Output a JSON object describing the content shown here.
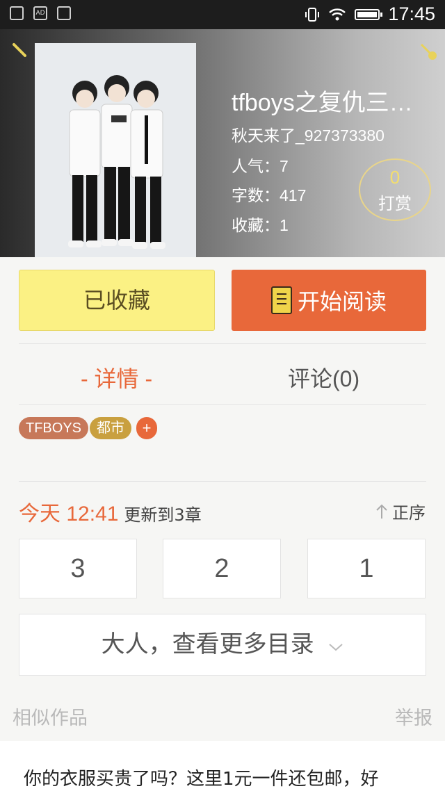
{
  "status_bar": {
    "time": "17:45"
  },
  "book": {
    "title": "tfboys之复仇三…",
    "author": "秋天来了_927373380",
    "popularity": "人气：7",
    "word_count": "字数：417",
    "favorites": "收藏：1",
    "reward_count": "0",
    "reward_label": "打赏"
  },
  "actions": {
    "favorite_label": "已收藏",
    "read_label": "开始阅读"
  },
  "tabs": {
    "details": "- 详情 -",
    "comments": "评论(0)"
  },
  "tags": [
    {
      "label": "TFBOYS",
      "color": "#c77859"
    },
    {
      "label": "都市",
      "color": "#c9a03f"
    },
    {
      "label": "+",
      "color": "#e8683a"
    }
  ],
  "update": {
    "time": "今天 12:41",
    "text": "更新到3章",
    "order_label": "正序"
  },
  "chapters": [
    "3",
    "2",
    "1"
  ],
  "more_catalog": "大人，查看更多目录",
  "similar": {
    "title": "相似作品",
    "report": "举报"
  },
  "ad": {
    "text": "你的衣服买贵了吗？这里1元一件还包邮，好"
  },
  "colors": {
    "accent": "#e8683a",
    "favorite_bg": "#fbf184"
  }
}
